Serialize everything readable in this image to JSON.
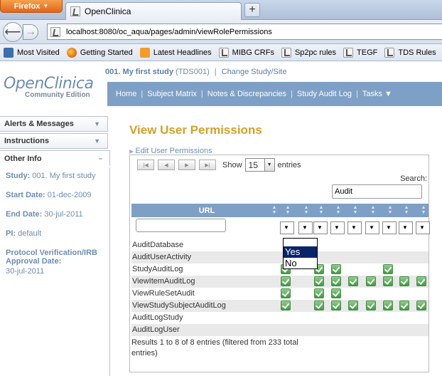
{
  "browser": {
    "menu_label": "Firefox",
    "tab_title": "OpenClinica",
    "new_tab": "+",
    "url": "localhost:8080/oc_aqua/pages/admin/viewRolePermissions",
    "bookmarks": [
      {
        "label": "Most Visited",
        "icon": "blue"
      },
      {
        "label": "Getting Started",
        "icon": "ff"
      },
      {
        "label": "Latest Headlines",
        "icon": "rss"
      },
      {
        "label": "MIBG CRFs",
        "icon": "oc"
      },
      {
        "label": "Sp2pc rules",
        "icon": "oc"
      },
      {
        "label": "TEGF",
        "icon": "oc"
      },
      {
        "label": "TDS Rules",
        "icon": "oc"
      },
      {
        "label": "T",
        "icon": "oc"
      }
    ]
  },
  "app": {
    "logo": "OpenClinica",
    "logo_sub": "Community Edition",
    "study_name": "001. My first study",
    "study_code": "(TDS001)",
    "separator": "|",
    "change_study": "Change Study/Site",
    "nav": [
      "Home",
      "Subject Matrix",
      "Notes & Discrepancies",
      "Study Audit Log",
      "Tasks ▼"
    ]
  },
  "sidebar": {
    "panels": [
      "Alerts & Messages",
      "Instructions"
    ],
    "other_info_title": "Other Info",
    "study_label": "Study:",
    "study_value": "001. My first study",
    "start_label": "Start Date:",
    "start_value": "01-dec-2009",
    "end_label": "End Date:",
    "end_value": "30-jul-2011",
    "pi_label": "PI:",
    "pi_value": "default",
    "irb_label": "Protocol Verification/IRB Approval Date:",
    "irb_value": "30-jul-2011"
  },
  "main": {
    "title": "View User Permissions",
    "edit_link": "Edit User Permissions",
    "show_label": "Show",
    "entries_value": "15",
    "entries_label": "entries",
    "search_label": "Search:",
    "search_value": "Audit",
    "url_header": "URL",
    "rows": [
      {
        "url": "AuditDatabase",
        "checks": []
      },
      {
        "url": "AuditUserActivity",
        "checks": []
      },
      {
        "url": "StudyAuditLog",
        "checks": [
          0,
          2,
          3,
          6
        ]
      },
      {
        "url": "ViewItemAuditLog",
        "checks": [
          0,
          2,
          3,
          4,
          5,
          6,
          7,
          8
        ]
      },
      {
        "url": "ViewRuleSetAudit",
        "checks": [
          0,
          2,
          3
        ]
      },
      {
        "url": "ViewStudySubjectAuditLog",
        "checks": [
          0,
          2,
          3,
          4,
          5,
          6,
          7,
          8
        ]
      },
      {
        "url": "AuditLogStudy",
        "checks": []
      },
      {
        "url": "AuditLogUser",
        "checks": []
      }
    ],
    "results_text": "Results 1 to 8 of 8 entries (filtered from 233 total entries)",
    "dropdown": {
      "yes": "Yes",
      "no": "No"
    }
  }
}
